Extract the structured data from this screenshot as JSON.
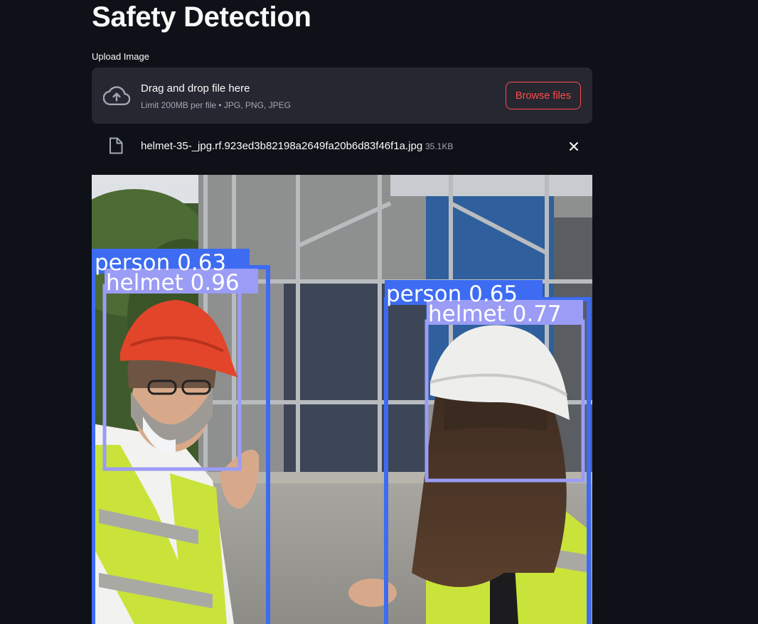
{
  "page": {
    "title": "Safety Detection"
  },
  "uploader": {
    "label": "Upload Image",
    "drop_text": "Drag and drop file here",
    "limit_text": "Limit 200MB per file • JPG, PNG, JPEG",
    "browse_label": "Browse files",
    "icon": "cloud-upload-icon"
  },
  "uploaded_file": {
    "name": "helmet-35-_jpg.rf.923ed3b82198a2649fa20b6d83f46f1a.jpg",
    "size": "35.1KB",
    "icon": "file-icon",
    "remove_icon": "close-icon"
  },
  "detections": [
    {
      "label": "person 0.63"
    },
    {
      "label": "helmet 0.96"
    },
    {
      "label": "person 0.65"
    },
    {
      "label": "helmet 0.77"
    }
  ],
  "colors": {
    "background": "#0e1117",
    "dropzone": "#262730",
    "accent": "#ff4b4b",
    "person_box": "#3d6cf2",
    "helmet_box": "#9a9cf5"
  }
}
